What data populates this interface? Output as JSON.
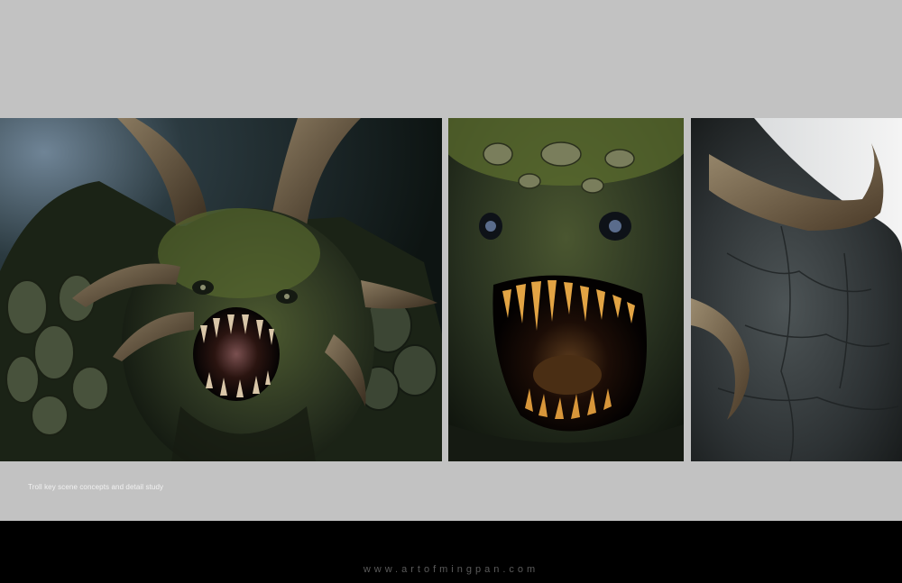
{
  "caption": "Troll key scene concepts and detail study",
  "website": "www.artofmingpan.com",
  "colors": {
    "background": "#c2c2c2",
    "band": "#000000",
    "skin_dark": "#1d2418",
    "moss": "#4b5a2a",
    "horn": "#5a4a35",
    "teeth": "#e0a040"
  },
  "panels": [
    {
      "id": "left",
      "content": "troll-full-head-image"
    },
    {
      "id": "mid",
      "content": "troll-mouth-detail-image"
    },
    {
      "id": "right",
      "content": "troll-horn-detail-image"
    }
  ]
}
